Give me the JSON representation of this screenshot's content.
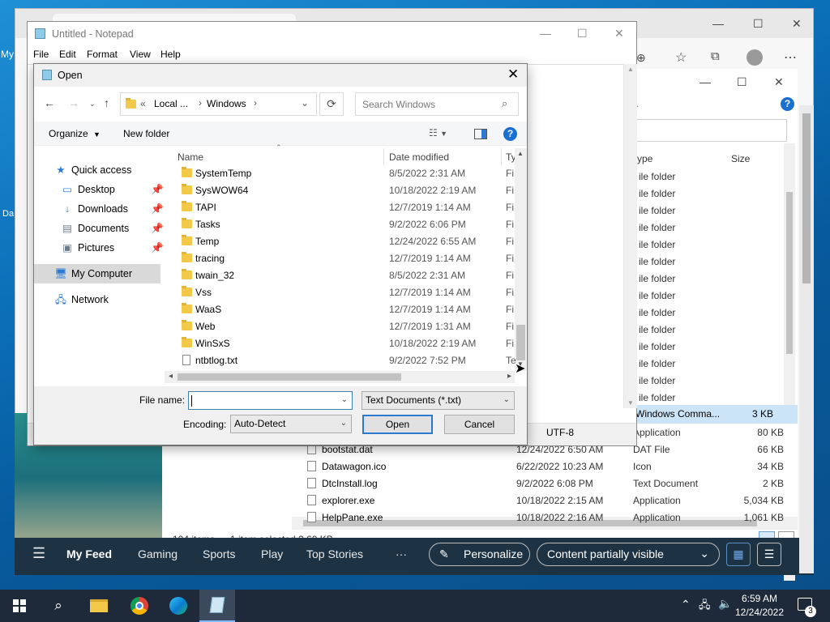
{
  "desktop": {
    "icon_labels": [
      "My",
      "Da"
    ]
  },
  "edge": {
    "toolbar_icons": [
      "favorites-icon",
      "collections-icon",
      "profile-icon",
      "more-icon"
    ],
    "feed": {
      "menu_icon": "hamburger-icon",
      "tabs": [
        "My Feed",
        "Gaming",
        "Sports",
        "Play",
        "Top Stories"
      ],
      "more": "···",
      "personalize": "Personalize",
      "content_select": "Content partially visible"
    }
  },
  "explorer": {
    "columns": [
      "ype",
      "Size"
    ],
    "type_rows": [
      "ile folder",
      "ile folder",
      "ile folder",
      "ile folder",
      "ile folder",
      "ile folder",
      "ile folder",
      "ile folder",
      "ile folder",
      "ile folder",
      "ile folder",
      "ile folder",
      "ile folder",
      "ile folder"
    ],
    "selected_row": {
      "type": "Windows Comma...",
      "size": "3 KB"
    },
    "files": [
      {
        "name": "",
        "date": "",
        "type": "Application",
        "size": "80 KB"
      },
      {
        "name": "bootstat.dat",
        "date": "12/24/2022 6:50 AM",
        "type": "DAT File",
        "size": "66 KB"
      },
      {
        "name": "Datawagon.ico",
        "date": "6/22/2022 10:23 AM",
        "type": "Icon",
        "size": "34 KB"
      },
      {
        "name": "DtcInstall.log",
        "date": "9/2/2022 6:08 PM",
        "type": "Text Document",
        "size": "2 KB"
      },
      {
        "name": "explorer.exe",
        "date": "10/18/2022 2:15 AM",
        "type": "Application",
        "size": "5,034 KB"
      },
      {
        "name": "HelpPane.exe",
        "date": "10/18/2022 2:16 AM",
        "type": "Application",
        "size": "1,061 KB"
      }
    ],
    "status": {
      "items": "104 items",
      "selected": "1 item selected  2.60 KB"
    }
  },
  "notepad": {
    "title": "Untitled - Notepad",
    "menu": [
      "File",
      "Edit",
      "Format",
      "View",
      "Help"
    ],
    "encoding_status": "UTF-8"
  },
  "dialog": {
    "title": "Open",
    "breadcrumb": [
      "«",
      "Local ...",
      "Windows"
    ],
    "search_placeholder": "Search Windows",
    "organize": "Organize",
    "new_folder": "New folder",
    "nav": {
      "quick_access": "Quick access",
      "desktop": "Desktop",
      "downloads": "Downloads",
      "documents": "Documents",
      "pictures": "Pictures",
      "my_computer": "My Computer",
      "network": "Network"
    },
    "columns": {
      "name": "Name",
      "date": "Date modified",
      "type": "Ty"
    },
    "files": [
      {
        "name": "SystemTemp",
        "date": "8/5/2022 2:31 AM",
        "type": "Fi",
        "kind": "folder"
      },
      {
        "name": "SysWOW64",
        "date": "10/18/2022 2:19 AM",
        "type": "Fi",
        "kind": "folder"
      },
      {
        "name": "TAPI",
        "date": "12/7/2019 1:14 AM",
        "type": "Fi",
        "kind": "folder"
      },
      {
        "name": "Tasks",
        "date": "9/2/2022 6:06 PM",
        "type": "Fi",
        "kind": "folder"
      },
      {
        "name": "Temp",
        "date": "12/24/2022 6:55 AM",
        "type": "Fi",
        "kind": "folder"
      },
      {
        "name": "tracing",
        "date": "12/7/2019 1:14 AM",
        "type": "Fi",
        "kind": "folder"
      },
      {
        "name": "twain_32",
        "date": "8/5/2022 2:31 AM",
        "type": "Fi",
        "kind": "folder"
      },
      {
        "name": "Vss",
        "date": "12/7/2019 1:14 AM",
        "type": "Fi",
        "kind": "folder"
      },
      {
        "name": "WaaS",
        "date": "12/7/2019 1:14 AM",
        "type": "Fi",
        "kind": "folder"
      },
      {
        "name": "Web",
        "date": "12/7/2019 1:31 AM",
        "type": "Fi",
        "kind": "folder"
      },
      {
        "name": "WinSxS",
        "date": "10/18/2022 2:19 AM",
        "type": "Fi",
        "kind": "folder"
      },
      {
        "name": "ntbtlog.txt",
        "date": "9/2/2022 7:52 PM",
        "type": "Te",
        "kind": "file"
      }
    ],
    "file_name_label": "File name:",
    "file_name_value": "",
    "file_type": "Text Documents (*.txt)",
    "encoding_label": "Encoding:",
    "encoding_value": "Auto-Detect",
    "open": "Open",
    "cancel": "Cancel"
  },
  "taskbar": {
    "time": "6:59 AM",
    "date": "12/24/2022",
    "notifications": "3",
    "apps": [
      "start-icon",
      "search-icon",
      "file-explorer-icon",
      "chrome-icon",
      "edge-icon",
      "notepad-icon"
    ]
  }
}
